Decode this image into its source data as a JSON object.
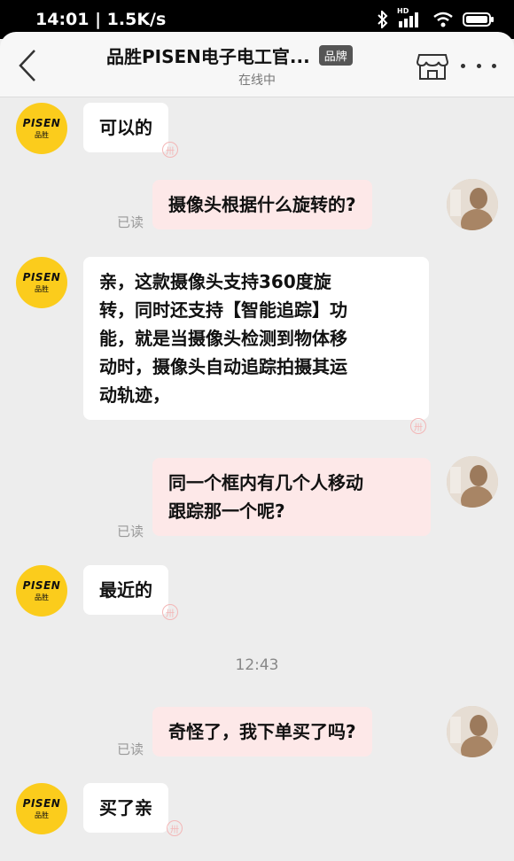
{
  "status": {
    "time": "14:01",
    "speed": "1.5K/s",
    "network": "HD"
  },
  "header": {
    "title": "品胜PISEN电子电工官...",
    "badge": "品牌",
    "subtitle": "在线中"
  },
  "shop_avatar": {
    "logo_en": "PISEN",
    "logo_cn": "品胜"
  },
  "messages": [
    {
      "from": "shop",
      "text": "可以的"
    },
    {
      "from": "user",
      "text": "摄像头根据什么旋转的?",
      "read": "已读"
    },
    {
      "from": "shop",
      "lines": [
        "亲，这款摄像头支持360度旋",
        "转，同时还支持【智能追踪】功",
        "能，就是当摄像头检测到物体移",
        "动时，摄像头自动追踪拍摄其运",
        "动轨迹，"
      ]
    },
    {
      "from": "user",
      "lines": [
        "同一个框内有几个人移动",
        "跟踪那一个呢?"
      ],
      "read": "已读"
    },
    {
      "from": "shop",
      "text": "最近的"
    },
    {
      "from": "user",
      "text": "奇怪了，我下单买了吗?",
      "read": "已读"
    },
    {
      "from": "shop",
      "text": "买了亲"
    }
  ],
  "timestamp": "12:43",
  "colors": {
    "background": "#ededed",
    "user_bubble": "#fde8e8",
    "shop_bubble": "#ffffff",
    "brand_yellow": "#fbcc1c"
  }
}
